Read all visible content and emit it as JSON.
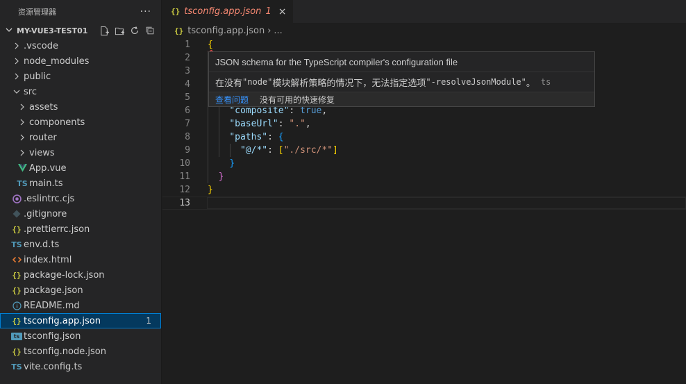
{
  "explorer": {
    "title": "资源管理器",
    "more": "···",
    "section": "MY-VUE3-TEST01",
    "items": [
      {
        "label": ".vscode",
        "type": "folder",
        "depth": 0,
        "expanded": false
      },
      {
        "label": "node_modules",
        "type": "folder",
        "depth": 0,
        "expanded": false
      },
      {
        "label": "public",
        "type": "folder",
        "depth": 0,
        "expanded": false
      },
      {
        "label": "src",
        "type": "folder",
        "depth": 0,
        "expanded": true
      },
      {
        "label": "assets",
        "type": "folder",
        "depth": 1,
        "expanded": false
      },
      {
        "label": "components",
        "type": "folder",
        "depth": 1,
        "expanded": false
      },
      {
        "label": "router",
        "type": "folder",
        "depth": 1,
        "expanded": false
      },
      {
        "label": "views",
        "type": "folder",
        "depth": 1,
        "expanded": false
      },
      {
        "label": "App.vue",
        "type": "vue",
        "depth": 1
      },
      {
        "label": "main.ts",
        "type": "ts",
        "depth": 1
      },
      {
        "label": ".eslintrc.cjs",
        "type": "eslint",
        "depth": 0
      },
      {
        "label": ".gitignore",
        "type": "git",
        "depth": 0
      },
      {
        "label": ".prettierrc.json",
        "type": "json",
        "depth": 0
      },
      {
        "label": "env.d.ts",
        "type": "ts",
        "depth": 0
      },
      {
        "label": "index.html",
        "type": "html",
        "depth": 0
      },
      {
        "label": "package-lock.json",
        "type": "json",
        "depth": 0
      },
      {
        "label": "package.json",
        "type": "json",
        "depth": 0
      },
      {
        "label": "README.md",
        "type": "info",
        "depth": 0
      },
      {
        "label": "tsconfig.app.json",
        "type": "json",
        "depth": 0,
        "selected": true,
        "badge": "1"
      },
      {
        "label": "tsconfig.json",
        "type": "tsbox",
        "depth": 0
      },
      {
        "label": "tsconfig.node.json",
        "type": "json",
        "depth": 0
      },
      {
        "label": "vite.config.ts",
        "type": "ts",
        "depth": 0
      }
    ]
  },
  "icons": {
    "json": "{}",
    "ts": "TS",
    "tsbox": "ts",
    "vue": "V",
    "html": "<>",
    "git": "◆",
    "info": "ⓘ",
    "eslint": "◉"
  },
  "tab": {
    "icon": "{}",
    "label": "tsconfig.app.json",
    "problems": "1",
    "close": "×"
  },
  "breadcrumb": {
    "icon": "{}",
    "file": "tsconfig.app.json",
    "sep": "›",
    "tail": "..."
  },
  "editor": {
    "line_numbers": [
      "1",
      "2",
      "3",
      "4",
      "5",
      "6",
      "7",
      "8",
      "9",
      "10",
      "11",
      "12",
      "13"
    ],
    "current_line": 13,
    "lines": [
      [
        [
          "{",
          "p1"
        ]
      ],
      [],
      [],
      [],
      [],
      [
        [
          "    ",
          "punc"
        ],
        [
          "\"composite\"",
          "key"
        ],
        [
          ": ",
          "punc"
        ],
        [
          "true",
          "bool"
        ],
        [
          ",",
          "punc"
        ]
      ],
      [
        [
          "    ",
          "punc"
        ],
        [
          "\"baseUrl\"",
          "key"
        ],
        [
          ": ",
          "punc"
        ],
        [
          "\".\"",
          "str"
        ],
        [
          ",",
          "punc"
        ]
      ],
      [
        [
          "    ",
          "punc"
        ],
        [
          "\"paths\"",
          "key"
        ],
        [
          ": ",
          "punc"
        ],
        [
          "{",
          "p3"
        ]
      ],
      [
        [
          "      ",
          "punc"
        ],
        [
          "\"@/*\"",
          "key"
        ],
        [
          ": ",
          "punc"
        ],
        [
          "[",
          "p1"
        ],
        [
          "\"./src/*\"",
          "str"
        ],
        [
          "]",
          "p1"
        ]
      ],
      [
        [
          "    ",
          "punc"
        ],
        [
          "}",
          "p3"
        ]
      ],
      [
        [
          "  ",
          "punc"
        ],
        [
          "}",
          "p2"
        ]
      ],
      [
        [
          "}",
          "p1"
        ]
      ],
      []
    ]
  },
  "hover": {
    "title": "JSON schema for the TypeScript compiler's configuration file",
    "msg_prefix": "在没有 ",
    "msg_code1": "\"node\"",
    "msg_middle": " 模块解析策略的情况下，无法指定选项 ",
    "msg_code2": "\"-resolveJsonModule\"",
    "msg_suffix": "。",
    "source": "ts",
    "action_view": "查看问题",
    "action_nofix": "没有可用的快速修复"
  },
  "colors": {
    "selection_bg": "#04395e",
    "selection_border": "#007fd4",
    "error": "#f48771",
    "link": "#3794ff"
  }
}
